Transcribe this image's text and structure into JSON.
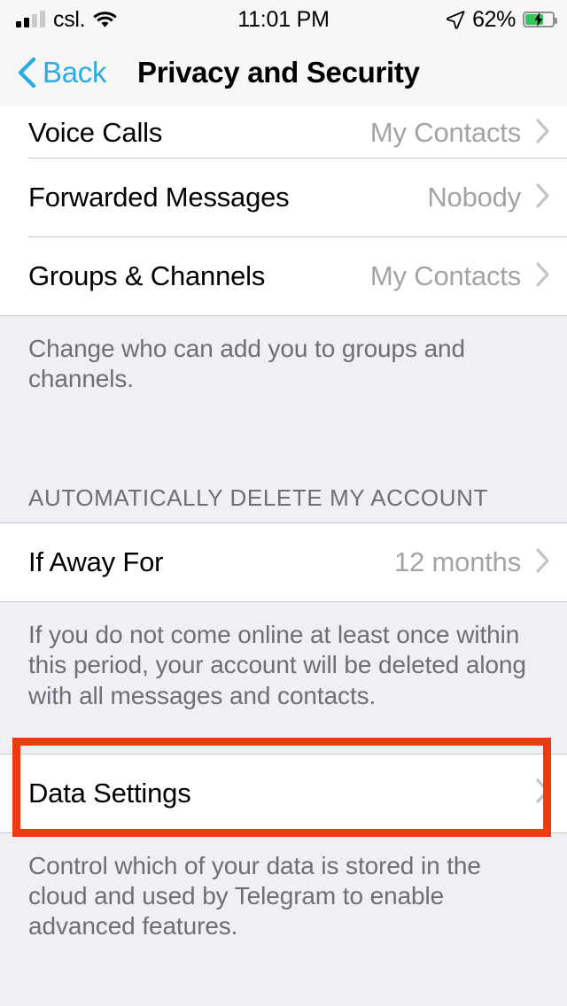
{
  "status_bar": {
    "carrier": "csl.",
    "signal_bars_filled": 2,
    "signal_bars_total": 4,
    "wifi_icon": "wifi-icon",
    "time": "11:01 PM",
    "location_icon": "location-arrow-icon",
    "battery_percent": "62%",
    "battery_level": 62,
    "battery_charging": true,
    "battery_fill_color": "#34C759"
  },
  "nav": {
    "back_icon": "chevron-left-icon",
    "back_label": "Back",
    "title": "Privacy and Security",
    "accent_color": "#2BABE2"
  },
  "sections": {
    "privacy": {
      "rows": [
        {
          "title": "Voice Calls",
          "value": "My Contacts",
          "disclosure": "chevron-right-icon"
        },
        {
          "title": "Forwarded Messages",
          "value": "Nobody",
          "disclosure": "chevron-right-icon"
        },
        {
          "title": "Groups & Channels",
          "value": "My Contacts",
          "disclosure": "chevron-right-icon"
        }
      ],
      "footer": "Change who can add you to groups and channels."
    },
    "auto_delete": {
      "header": "AUTOMATICALLY DELETE MY ACCOUNT",
      "rows": [
        {
          "title": "If Away For",
          "value": "12 months",
          "disclosure": "chevron-right-icon"
        }
      ],
      "footer": "If you do not come online at least once within this period, your account will be deleted along with all messages and contacts."
    },
    "data": {
      "rows": [
        {
          "title": "Data Settings",
          "value": "",
          "disclosure": "chevron-right-icon"
        }
      ],
      "footer": "Control which of your data is stored in the cloud and used by Telegram to enable advanced features."
    }
  },
  "annotation": {
    "target": "Data Settings",
    "color": "#EE3A11"
  }
}
